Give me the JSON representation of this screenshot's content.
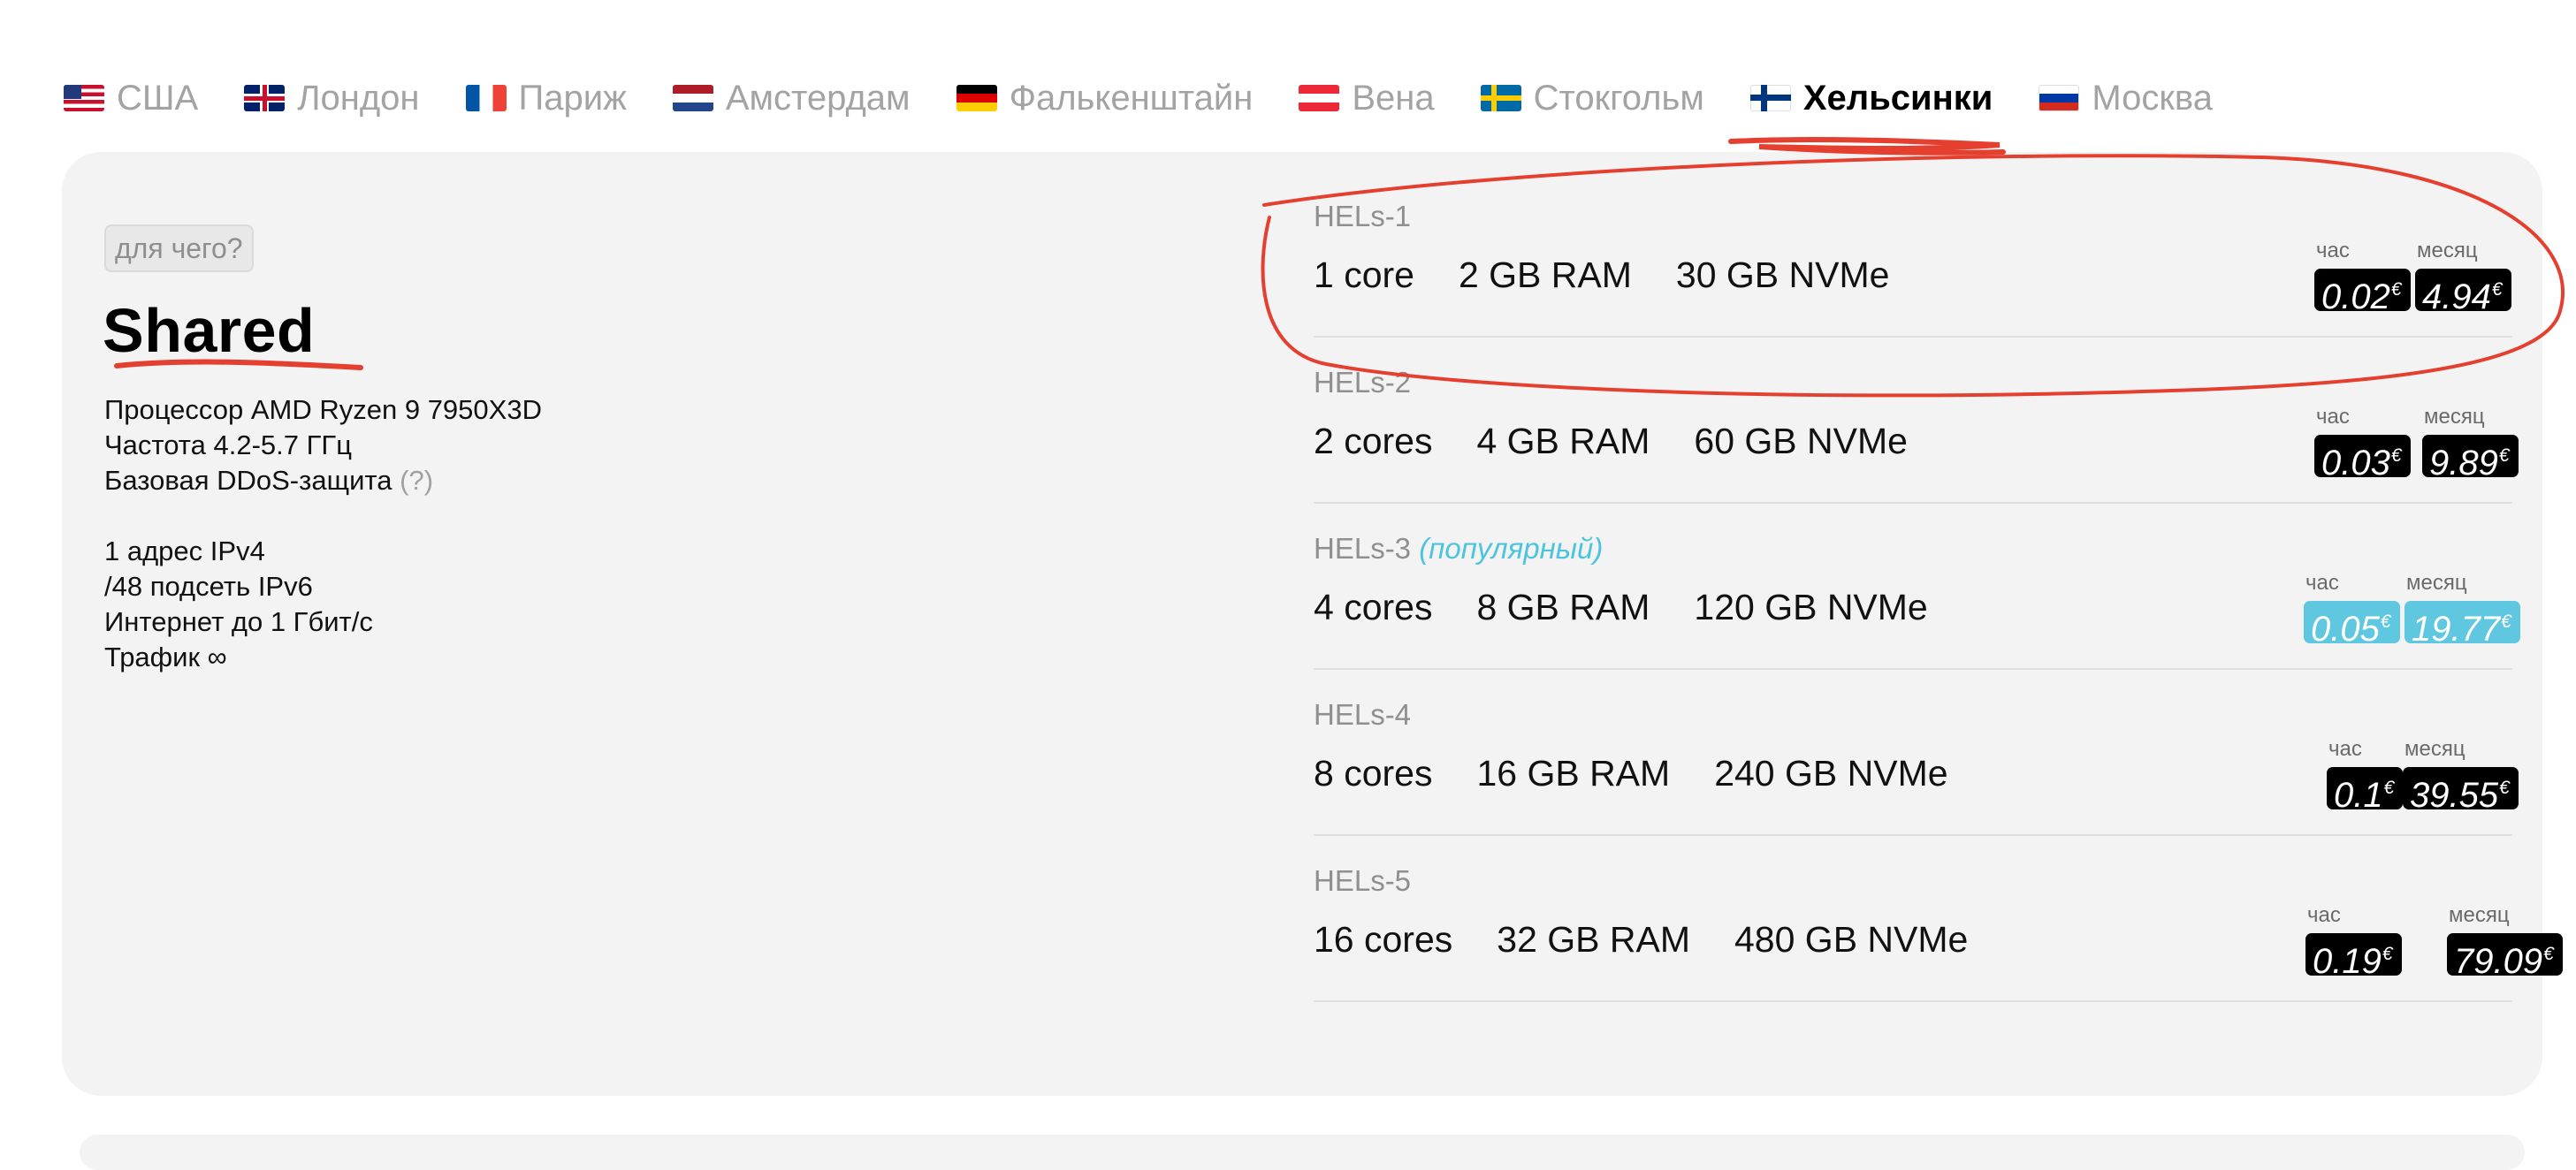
{
  "tabs": [
    {
      "label": "США",
      "flag": "flag-us-icon",
      "active": false
    },
    {
      "label": "Лондон",
      "flag": "flag-gb-icon",
      "active": false
    },
    {
      "label": "Париж",
      "flag": "flag-fr-icon",
      "active": false
    },
    {
      "label": "Амстердам",
      "flag": "flag-nl-icon",
      "active": false
    },
    {
      "label": "Фалькенштайн",
      "flag": "flag-de-icon",
      "active": false
    },
    {
      "label": "Вена",
      "flag": "flag-at-icon",
      "active": false
    },
    {
      "label": "Стокгольм",
      "flag": "flag-se-icon",
      "active": false
    },
    {
      "label": "Хельсинки",
      "flag": "flag-fi-icon",
      "active": true
    },
    {
      "label": "Москва",
      "flag": "flag-ru-icon",
      "active": false
    }
  ],
  "info": {
    "help_button": "для чего?",
    "title": "Shared",
    "cpu": "Процессор AMD Ryzen 9 7950X3D",
    "frequency": "Частота 4.2-5.7 ГГц",
    "ddos": "Базовая DDoS-защита",
    "ddos_hint": "(?)",
    "ipv4": "1 адрес IPv4",
    "ipv6": "/48 подсеть IPv6",
    "internet": "Интернет до 1 Гбит/с",
    "traffic": "Трафик ∞"
  },
  "labels": {
    "hour": "час",
    "month": "месяц",
    "currency": "€"
  },
  "plans": [
    {
      "name": "HELs-1",
      "badge": "",
      "cores": "1 core",
      "ram": "2 GB RAM",
      "disk": "30 GB NVMe",
      "price_hour": "0.02",
      "price_month": "4.94",
      "highlight": false
    },
    {
      "name": "HELs-2",
      "badge": "",
      "cores": "2 cores",
      "ram": "4 GB RAM",
      "disk": "60 GB NVMe",
      "price_hour": "0.03",
      "price_month": "9.89",
      "highlight": false
    },
    {
      "name": "HELs-3",
      "badge": "(популярный)",
      "cores": "4 cores",
      "ram": "8 GB RAM",
      "disk": "120 GB NVMe",
      "price_hour": "0.05",
      "price_month": "19.77",
      "highlight": true
    },
    {
      "name": "HELs-4",
      "badge": "",
      "cores": "8 cores",
      "ram": "16 GB RAM",
      "disk": "240 GB NVMe",
      "price_hour": "0.1",
      "price_month": "39.55",
      "highlight": false
    },
    {
      "name": "HELs-5",
      "badge": "",
      "cores": "16 cores",
      "ram": "32 GB RAM",
      "disk": "480 GB NVMe",
      "price_hour": "0.19",
      "price_month": "79.09",
      "highlight": false
    }
  ],
  "colors": {
    "accent": "#5fc7df",
    "annotation": "#e5402f",
    "card": "#f3f3f3"
  }
}
